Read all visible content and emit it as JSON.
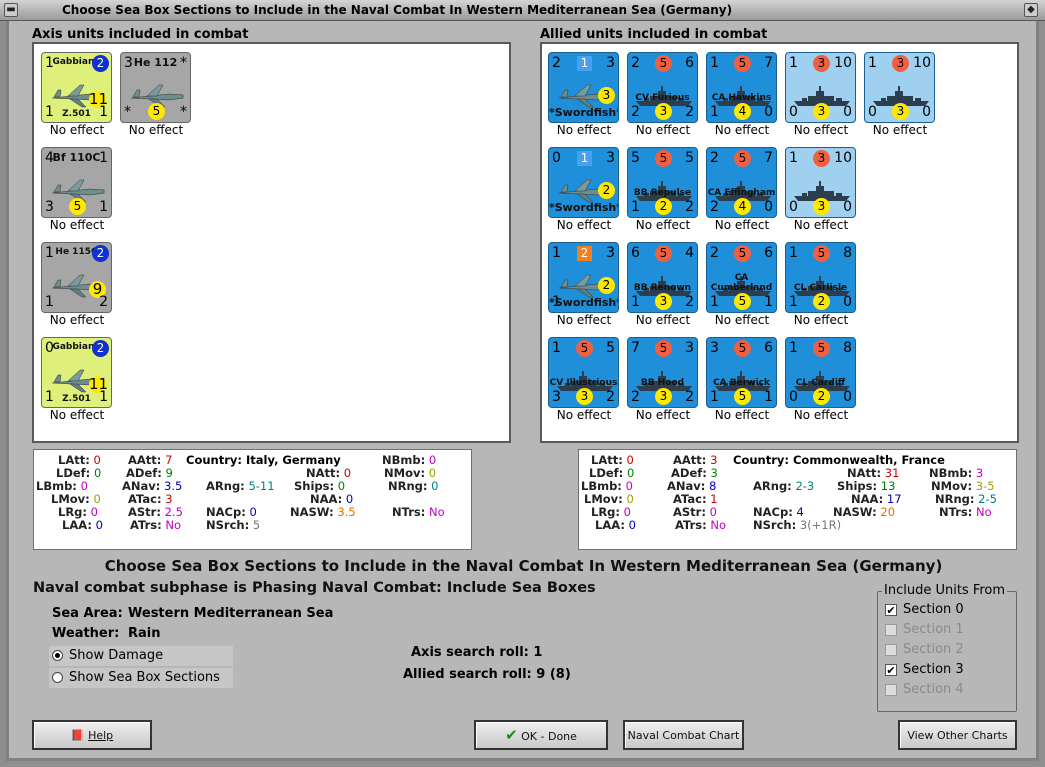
{
  "window": {
    "title": "Choose Sea Box Sections to Include in the Naval Combat In Western Mediterranean Sea (Germany)"
  },
  "axis": {
    "header": "Axis units included in combat",
    "units": [
      {
        "name": "Gabbiano",
        "nums": [
          "1",
          "2",
          "11",
          "1",
          "1"
        ],
        "type": "Z.501",
        "effect": "No effect"
      },
      {
        "name": "He 112",
        "nums": [
          "3",
          "*",
          "5",
          "*",
          "*"
        ],
        "effect": "No effect"
      },
      {
        "name": "Bf 110C",
        "nums": [
          "4",
          "1",
          "5",
          "3",
          "1"
        ],
        "effect": "No effect"
      },
      {
        "name": "He 115C",
        "nums": [
          "1",
          "2",
          "9",
          "1",
          "2"
        ],
        "effect": "No effect"
      },
      {
        "name": "Gabbiano",
        "nums": [
          "0",
          "2",
          "11",
          "1",
          "1"
        ],
        "type": "Z.501",
        "effect": "No effect"
      }
    ]
  },
  "allied": {
    "header": "Allied units included in combat",
    "units": [
      {
        "name": "Swordfish",
        "tl": "2",
        "sq": "1",
        "tr": "3",
        "yc": "3",
        "bl": "",
        "br": "",
        "effect": "No effect"
      },
      {
        "name": "CV Furious",
        "tl": "2",
        "oc": "5",
        "tr": "6",
        "bl": "2",
        "yc": "3",
        "br": "2",
        "effect": "No effect"
      },
      {
        "name": "CA Hawkins",
        "tl": "1",
        "oc": "5",
        "tr": "7",
        "bl": "1",
        "yc": "4",
        "br": "0",
        "effect": "No effect"
      },
      {
        "name": "",
        "tl": "1",
        "oc": "3",
        "tr": "10",
        "bl": "0",
        "yc": "3",
        "br": "0",
        "effect": "No effect"
      },
      {
        "name": "",
        "tl": "1",
        "oc": "3",
        "tr": "10",
        "bl": "0",
        "yc": "3",
        "br": "0",
        "effect": "No effect"
      },
      {
        "name": "Swordfish",
        "tl": "0",
        "sq": "1",
        "tr": "3",
        "yc": "2",
        "bl": "",
        "br": "",
        "effect": "No effect"
      },
      {
        "name": "BB Repulse",
        "tl": "5",
        "oc": "5",
        "tr": "5",
        "bl": "1",
        "yc": "2",
        "br": "2",
        "effect": "No effect"
      },
      {
        "name": "CA Effingham",
        "tl": "2",
        "oc": "5",
        "tr": "7",
        "bl": "2",
        "yc": "4",
        "br": "0",
        "effect": "No effect"
      },
      {
        "name": "",
        "tl": "1",
        "oc": "3",
        "tr": "10",
        "bl": "0",
        "yc": "3",
        "br": "0",
        "effect": "No effect"
      },
      {
        "name": "Swordfish",
        "tl": "1",
        "sq": "2",
        "tr": "3",
        "yc": "2",
        "bl": "1",
        "br": "",
        "effect": "No effect"
      },
      {
        "name": "BB Renown",
        "tl": "6",
        "oc": "5",
        "tr": "4",
        "bl": "1",
        "yc": "3",
        "br": "2",
        "effect": "No effect"
      },
      {
        "name": "CA Cumberland",
        "tl": "2",
        "oc": "5",
        "tr": "6",
        "bl": "1",
        "yc": "5",
        "br": "1",
        "effect": "No effect"
      },
      {
        "name": "CL Carlisle",
        "tl": "1",
        "oc": "5",
        "tr": "8",
        "bl": "1",
        "yc": "2",
        "br": "0",
        "effect": "No effect"
      },
      {
        "name": "CV Illustrious",
        "tl": "1",
        "oc": "5",
        "tr": "5",
        "bl": "3",
        "yc": "3",
        "br": "2",
        "effect": "No effect"
      },
      {
        "name": "BB Hood",
        "tl": "7",
        "oc": "5",
        "tr": "3",
        "bl": "2",
        "yc": "3",
        "br": "2",
        "effect": "No effect"
      },
      {
        "name": "CA Berwick",
        "tl": "3",
        "oc": "5",
        "tr": "6",
        "bl": "1",
        "yc": "5",
        "br": "1",
        "effect": "No effect"
      },
      {
        "name": "CL Cardiff",
        "tl": "1",
        "oc": "5",
        "tr": "8",
        "bl": "0",
        "yc": "2",
        "br": "0",
        "effect": "No effect"
      }
    ]
  },
  "axis_stats": {
    "latt": "0",
    "ldef": "0",
    "lbmb": "0",
    "lmov": "0",
    "lrg": "0",
    "laa": "0",
    "aatt": "7",
    "adef": "9",
    "anav": "3.5",
    "atac": "3",
    "astr": "2.5",
    "atrs": "No",
    "country": "Country: Italy, Germany",
    "arng": "5-11",
    "nacp": "0",
    "nsrch": "5",
    "natt": "0",
    "ships": "0",
    "naa": "0",
    "nasw": "3.5",
    "nbmb": "0",
    "nmov": "0",
    "nrng": "0",
    "ntrs": "No"
  },
  "allied_stats": {
    "latt": "0",
    "ldef": "0",
    "lbmb": "0",
    "lmov": "0",
    "lrg": "0",
    "laa": "0",
    "aatt": "3",
    "adef": "3",
    "anav": "8",
    "atac": "1",
    "astr": "0",
    "atrs": "No",
    "country": "Country: Commonwealth, France",
    "arng": "2-3",
    "nacp": "4",
    "nsrch": "3(+1R)",
    "natt": "31",
    "ships": "13",
    "naa": "17",
    "nasw": "20",
    "nbmb": "3",
    "nmov": "3-5",
    "nrng": "2-5",
    "ntrs": "No"
  },
  "labels": {
    "latt": "LAtt:",
    "ldef": "LDef:",
    "lbmb": "LBmb:",
    "lmov": "LMov:",
    "lrg": "LRg:",
    "laa": "LAA:",
    "aatt": "AAtt:",
    "adef": "ADef:",
    "anav": "ANav:",
    "atac": "ATac:",
    "astr": "AStr:",
    "atrs": "ATrs:",
    "arng": "ARng:",
    "nacp": "NACp:",
    "nsrch": "NSrch:",
    "natt": "NAtt:",
    "ships": "Ships:",
    "naa": "NAA:",
    "nasw": "NASW:",
    "nbmb": "NBmb:",
    "nmov": "NMov:",
    "nrng": "NRng:",
    "ntrs": "NTrs:"
  },
  "info": {
    "heading": "Choose Sea Box Sections to Include in the Naval Combat In Western Mediterranean Sea (Germany)",
    "subphase": "Naval combat subphase is Phasing Naval Combat: Include Sea Boxes",
    "sea_area_label": "Sea Area:",
    "sea_area": "Western Mediterranean Sea",
    "weather_label": "Weather:",
    "weather": "Rain",
    "show_damage": "Show Damage",
    "show_sections": "Show Sea Box Sections",
    "axis_search": "Axis search roll: 1",
    "allied_search": "Allied search roll: 9 (8)"
  },
  "include": {
    "title": "Include Units From",
    "sections": [
      {
        "label": "Section 0",
        "checked": true,
        "enabled": true
      },
      {
        "label": "Section 1",
        "checked": false,
        "enabled": false
      },
      {
        "label": "Section 2",
        "checked": false,
        "enabled": false
      },
      {
        "label": "Section 3",
        "checked": true,
        "enabled": true
      },
      {
        "label": "Section 4",
        "checked": false,
        "enabled": false
      }
    ]
  },
  "buttons": {
    "help": "Help",
    "ok": "OK - Done",
    "naval_chart": "Naval Combat Chart",
    "other_charts": "View Other Charts"
  },
  "colors": {
    "axis_yellow": "#dff07a",
    "axis_gray": "#a6a6a6",
    "allied_blue": "#1e8fd8",
    "allied_light": "#9fd0f0",
    "red_val": "#d00000",
    "green_val": "#008000",
    "blue_val": "#0000c0",
    "orange_val": "#e07000",
    "purple_val": "#c000c0"
  }
}
